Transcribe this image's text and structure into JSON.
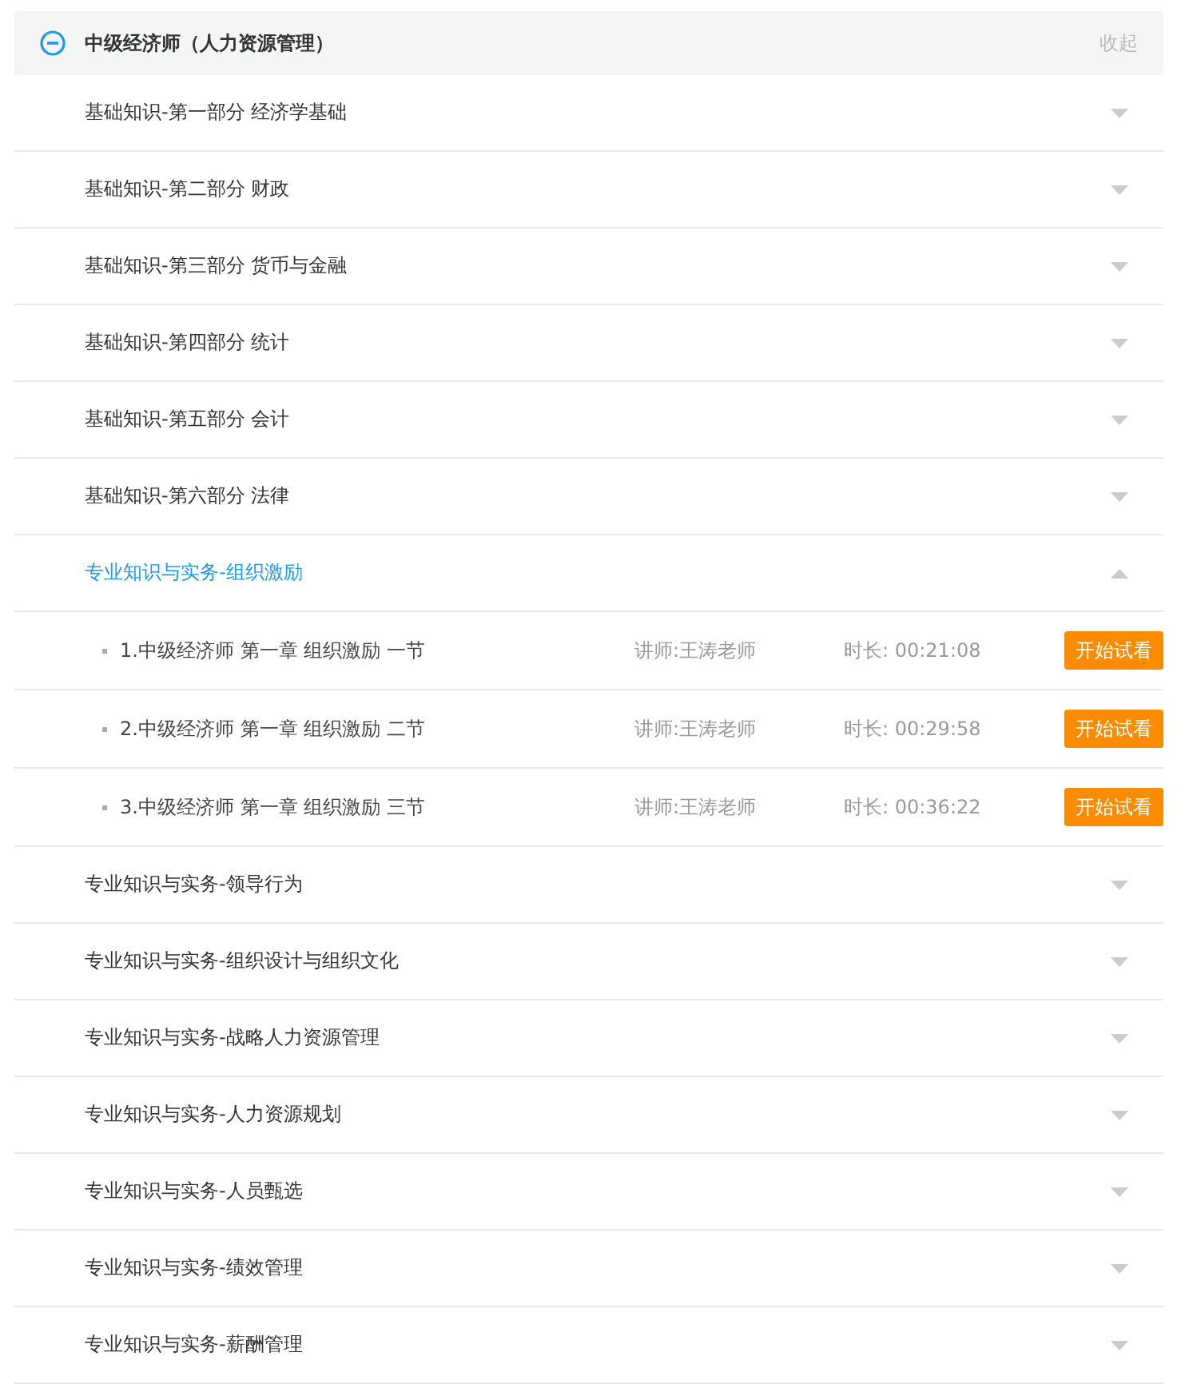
{
  "course": {
    "title": "中级经济师（人力资源管理）",
    "expanded": true,
    "toggle": "收起"
  },
  "sections": [
    {
      "title": "基础知识-第一部分 经济学基础",
      "expanded": false
    },
    {
      "title": "基础知识-第二部分 财政",
      "expanded": false
    },
    {
      "title": "基础知识-第三部分 货币与金融",
      "expanded": false
    },
    {
      "title": "基础知识-第四部分 统计",
      "expanded": false
    },
    {
      "title": "基础知识-第五部分 会计",
      "expanded": false
    },
    {
      "title": "基础知识-第六部分 法律",
      "expanded": false
    },
    {
      "title": "专业知识与实务-组织激励",
      "expanded": true,
      "lessons": [
        {
          "title": "1.中级经济师 第一章 组织激励 一节",
          "teacher": "讲师:王涛老师",
          "duration": "时长: 00:21:08",
          "button": "开始试看"
        },
        {
          "title": "2.中级经济师 第一章 组织激励 二节",
          "teacher": "讲师:王涛老师",
          "duration": "时长: 00:29:58",
          "button": "开始试看"
        },
        {
          "title": "3.中级经济师 第一章 组织激励 三节",
          "teacher": "讲师:王涛老师",
          "duration": "时长: 00:36:22",
          "button": "开始试看"
        }
      ]
    },
    {
      "title": "专业知识与实务-领导行为",
      "expanded": false
    },
    {
      "title": "专业知识与实务-组织设计与组织文化",
      "expanded": false
    },
    {
      "title": "专业知识与实务-战略人力资源管理",
      "expanded": false
    },
    {
      "title": "专业知识与实务-人力资源规划",
      "expanded": false
    },
    {
      "title": "专业知识与实务-人员甄选",
      "expanded": false
    },
    {
      "title": "专业知识与实务-绩效管理",
      "expanded": false
    },
    {
      "title": "专业知识与实务-薪酬管理",
      "expanded": false
    }
  ]
}
